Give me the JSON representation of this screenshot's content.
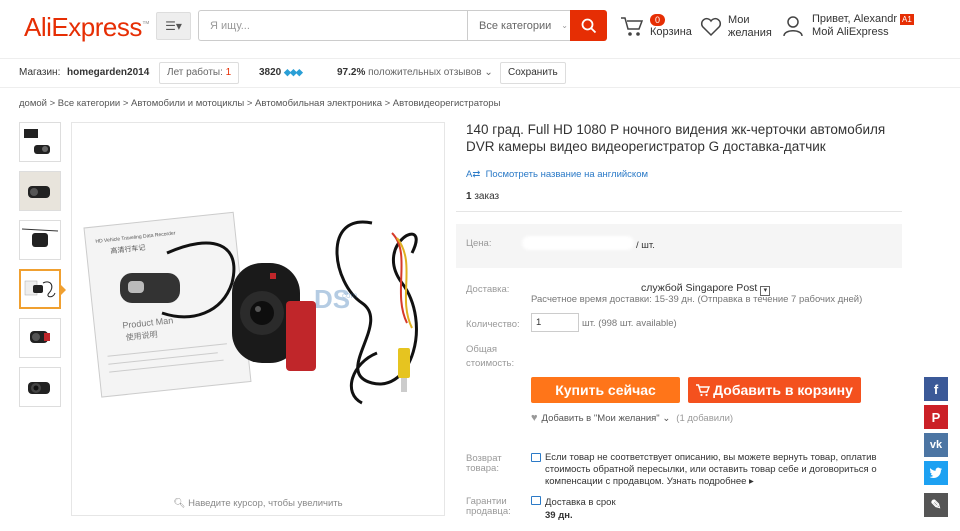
{
  "header": {
    "logo": "AliExpress",
    "logo_mark": "™",
    "search_placeholder": "Я ищу...",
    "category_select": "Все категории",
    "cart_count": "0",
    "cart_label": "Корзина",
    "wishlist_line1": "Мои",
    "wishlist_line2": "желания",
    "greeting": "Привет, Alexandr",
    "greeting_badge": "A1",
    "my_account": "Мой AliExpress"
  },
  "store_bar": {
    "store_label": "Магазин:",
    "store_name": "homegarden2014",
    "years_label": "Лет работы:",
    "years_value": "1",
    "rating_points": "3820",
    "positive_percent": "97.2%",
    "positive_label": "положительных отзывов",
    "save_label": "Сохранить"
  },
  "breadcrumb": "домой > Все категории > Автомобили и мотоциклы > Автомобильная электроника > Автовидеорегистраторы",
  "gallery": {
    "zoom_hint": "Наведите курсор, чтобы увеличить",
    "watermark": "DS",
    "watermark_small": "com",
    "manual_header": "HD Vehicle Traveling Data Recorder",
    "manual_cn": "高清行车记",
    "manual_title": "Product Man",
    "manual_cn2": "使用说明"
  },
  "product": {
    "title": "140 град. Full HD 1080 P ночного видения жк-черточки автомобиля DVR камеры видео видеорегистратор G доставка-датчик",
    "translate_link": "Посмотреть название на английском",
    "orders_count": "1",
    "orders_label": "заказ",
    "price_label": "Цена:",
    "price_unit": "/ шт.",
    "shipping_label": "Доставка:",
    "shipping_value": "службой Singapore Post",
    "shipping_time": "Расчетное время доставки: 15-39 дн. (Отправка в течение 7 рабочих дней)",
    "qty_label": "Количество:",
    "qty_value": "1",
    "qty_note": "шт. (998 шт. available)",
    "total_label_1": "Общая",
    "total_label_2": "стоимость:",
    "buy_now": "Купить сейчас",
    "add_to_cart": "Добавить в корзину",
    "wishlist_add": "Добавить в \"Мои желания\"",
    "wishlist_count": "(1 добавили)",
    "return_label_1": "Возврат",
    "return_label_2": "товара:",
    "return_text": "Если товар не соответствует описанию, вы можете вернуть товар, оплатив стоимость обратной пересылки, или оставить товар себе и договориться о компенсации с продавцом.",
    "return_more": "Узнать подробнее",
    "guarantee_label_1": "Гарантии",
    "guarantee_label_2": "продавца:",
    "guarantee_text": "Доставка в срок",
    "guarantee_days": "39 дн."
  },
  "colors": {
    "brand": "#e62e04",
    "buy": "#ff7519",
    "cart": "#f4511e",
    "facebook": "#3b5998",
    "pinterest": "#cb2027",
    "vk": "#4c75a3",
    "twitter": "#1da1f2",
    "edit": "#555555"
  },
  "social": [
    "facebook-icon",
    "pinterest-icon",
    "vk-icon",
    "twitter-icon",
    "edit-icon"
  ],
  "social_glyphs": {
    "facebook": "f",
    "pinterest": "P",
    "vk": "vk",
    "edit": "✎"
  }
}
